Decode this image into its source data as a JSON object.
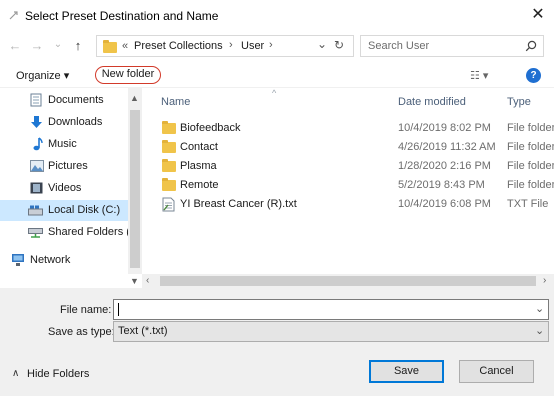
{
  "dialog": {
    "title": "Select Preset Destination and Name",
    "close_glyph": "✕"
  },
  "nav": {
    "back": "←",
    "forward": "→",
    "recent": "⌄",
    "up": "↑",
    "breadcrumb_prefix": "«",
    "crumbs": [
      "Preset Collections",
      "User"
    ],
    "sep": "›",
    "dropdown": "⌄",
    "refresh": "↻",
    "search_placeholder": "Search User",
    "search_icon_glyph": "⌕"
  },
  "toolbar": {
    "organize": "Organize ▾",
    "new_folder": "New folder",
    "view_glyph": "☷ ▾",
    "help": "?"
  },
  "sidebar": {
    "items": [
      {
        "label": "Documents",
        "icon": "documents-icon"
      },
      {
        "label": "Downloads",
        "icon": "downloads-icon"
      },
      {
        "label": "Music",
        "icon": "music-icon"
      },
      {
        "label": "Pictures",
        "icon": "pictures-icon"
      },
      {
        "label": "Videos",
        "icon": "videos-icon"
      },
      {
        "label": "Local Disk (C:)",
        "icon": "drive-icon",
        "selected": true
      },
      {
        "label": "Shared Folders (\\",
        "icon": "network-drive-icon"
      },
      {
        "label": "Network",
        "icon": "network-icon"
      }
    ]
  },
  "files": {
    "columns": {
      "name": "Name",
      "date": "Date modified",
      "type": "Type"
    },
    "rows": [
      {
        "name": "Biofeedback",
        "date": "10/4/2019 8:02 PM",
        "type": "File folder",
        "kind": "folder"
      },
      {
        "name": "Contact",
        "date": "4/26/2019 11:32 AM",
        "type": "File folder",
        "kind": "folder"
      },
      {
        "name": "Plasma",
        "date": "1/28/2020 2:16 PM",
        "type": "File folder",
        "kind": "folder"
      },
      {
        "name": "Remote",
        "date": "5/2/2019 8:43 PM",
        "type": "File folder",
        "kind": "folder"
      },
      {
        "name": "YI Breast Cancer (R).txt",
        "date": "10/4/2019 6:08 PM",
        "type": "TXT File",
        "kind": "txt"
      }
    ]
  },
  "form": {
    "file_name_label": "File name:",
    "file_name_value": "",
    "save_type_label": "Save as type:",
    "save_type_value": "Text (*.txt)",
    "combo_arrow": "⌄"
  },
  "footer": {
    "hide_folders": "Hide Folders",
    "hide_glyph": "∧",
    "save": "Save",
    "cancel": "Cancel"
  }
}
